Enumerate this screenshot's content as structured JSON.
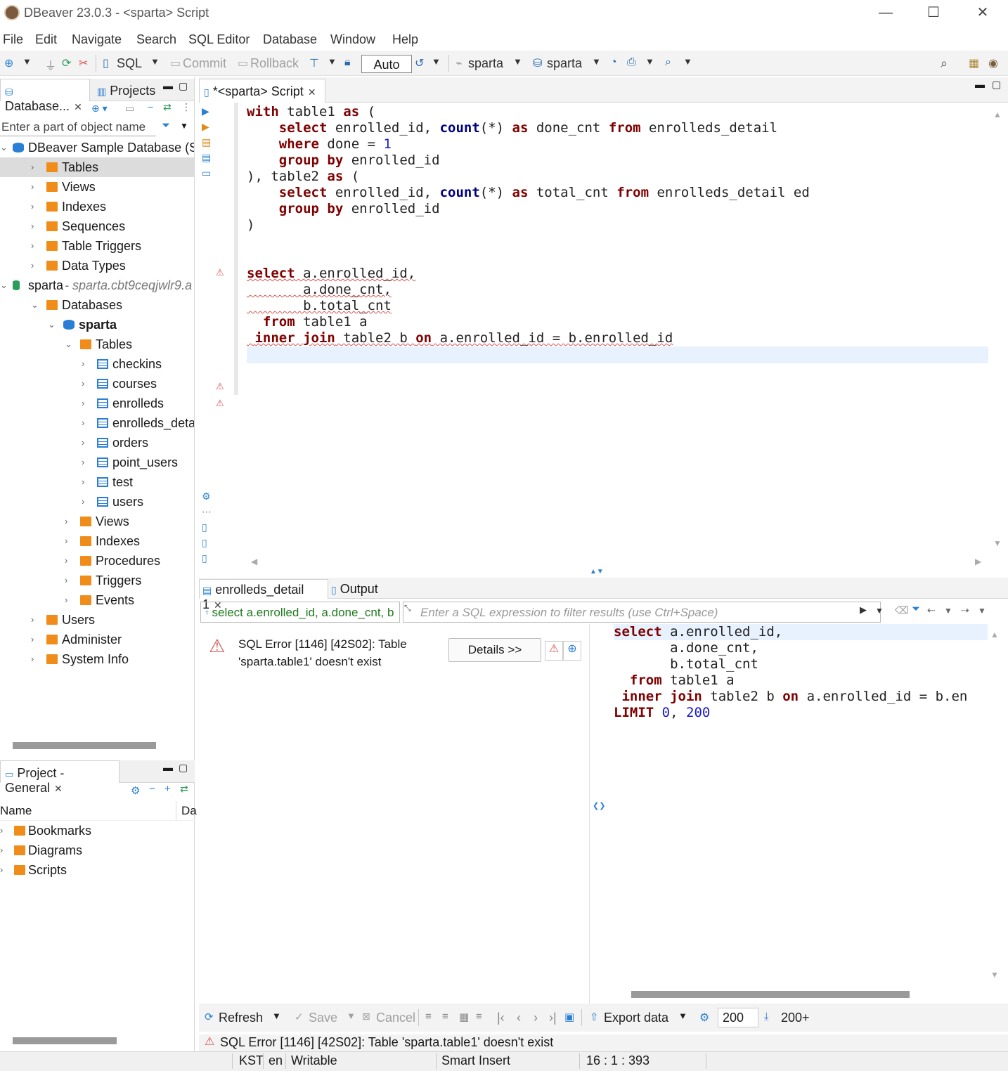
{
  "window": {
    "title": "DBeaver 23.0.3 - <sparta> Script",
    "minimize": "—",
    "maximize": "☐",
    "close": "✕"
  },
  "menu": [
    "File",
    "Edit",
    "Navigate",
    "Search",
    "SQL Editor",
    "Database",
    "Window",
    "Help"
  ],
  "toolbar": {
    "sql": "SQL",
    "commit": "Commit",
    "rollback": "Rollback",
    "auto": "Auto",
    "datasource": "sparta",
    "schema": "sparta"
  },
  "navigator": {
    "tab_db": "Database...",
    "tab_projects": "Projects",
    "filter_placeholder": "Enter a part of object name",
    "items": [
      {
        "label": "DBeaver Sample Database (SC",
        "level": 0,
        "chev": "⌄",
        "icon": "db"
      },
      {
        "label": "Tables",
        "level": 1,
        "chev": "›",
        "icon": "tables",
        "selected": true
      },
      {
        "label": "Views",
        "level": 1,
        "chev": "›",
        "icon": "folder"
      },
      {
        "label": "Indexes",
        "level": 1,
        "chev": "›",
        "icon": "folder"
      },
      {
        "label": "Sequences",
        "level": 1,
        "chev": "›",
        "icon": "folder"
      },
      {
        "label": "Table Triggers",
        "level": 1,
        "chev": "›",
        "icon": "folder"
      },
      {
        "label": "Data Types",
        "level": 1,
        "chev": "›",
        "icon": "folder"
      },
      {
        "label": "sparta",
        "sub": " - sparta.cbt9ceqjwlr9.a",
        "level": 0,
        "chev": "⌄",
        "icon": "conn"
      },
      {
        "label": "Databases",
        "level": 1,
        "chev": "⌄",
        "icon": "folder"
      },
      {
        "label": "sparta",
        "level": 2,
        "chev": "⌄",
        "icon": "db",
        "bold": true
      },
      {
        "label": "Tables",
        "level": 3,
        "chev": "⌄",
        "icon": "tables"
      },
      {
        "label": "checkins",
        "level": 4,
        "chev": "›",
        "icon": "table"
      },
      {
        "label": "courses",
        "level": 4,
        "chev": "›",
        "icon": "table"
      },
      {
        "label": "enrolleds",
        "level": 4,
        "chev": "›",
        "icon": "table"
      },
      {
        "label": "enrolleds_detail",
        "level": 4,
        "chev": "›",
        "icon": "table"
      },
      {
        "label": "orders",
        "level": 4,
        "chev": "›",
        "icon": "table"
      },
      {
        "label": "point_users",
        "level": 4,
        "chev": "›",
        "icon": "table"
      },
      {
        "label": "test",
        "level": 4,
        "chev": "›",
        "icon": "table"
      },
      {
        "label": "users",
        "level": 4,
        "chev": "›",
        "icon": "table"
      },
      {
        "label": "Views",
        "level": 3,
        "chev": "›",
        "icon": "folder"
      },
      {
        "label": "Indexes",
        "level": 3,
        "chev": "›",
        "icon": "folder"
      },
      {
        "label": "Procedures",
        "level": 3,
        "chev": "›",
        "icon": "folder"
      },
      {
        "label": "Triggers",
        "level": 3,
        "chev": "›",
        "icon": "folder"
      },
      {
        "label": "Events",
        "level": 3,
        "chev": "›",
        "icon": "folder"
      },
      {
        "label": "Users",
        "level": 1,
        "chev": "›",
        "icon": "folder"
      },
      {
        "label": "Administer",
        "level": 1,
        "chev": "›",
        "icon": "folder"
      },
      {
        "label": "System Info",
        "level": 1,
        "chev": "›",
        "icon": "folder"
      }
    ]
  },
  "project": {
    "tab": "Project - General",
    "col_name": "Name",
    "col_da": "Da",
    "items": [
      "Bookmarks",
      "Diagrams",
      "Scripts"
    ]
  },
  "editor": {
    "tab": "*<sparta> Script"
  },
  "results": {
    "tab1": "enrolleds_detail 1",
    "tab2": "Output",
    "query": "select a.enrolled_id, a.done_cnt, b",
    "filter_placeholder": "Enter a SQL expression to filter results (use Ctrl+Space)",
    "error_message": "SQL Error [1146] [42S02]: Table 'sparta.table1' doesn't exist",
    "details_button": "Details >>",
    "refresh": "Refresh",
    "save": "Save",
    "cancel": "Cancel",
    "export": "Export data",
    "rows": "200",
    "rows_more": "200+"
  },
  "status": {
    "error": "SQL Error [1146] [42S02]: Table 'sparta.table1' doesn't exist",
    "tz": "KST",
    "lang": "en",
    "mode": "Writable",
    "insert": "Smart Insert",
    "position": "16 : 1 : 393"
  }
}
